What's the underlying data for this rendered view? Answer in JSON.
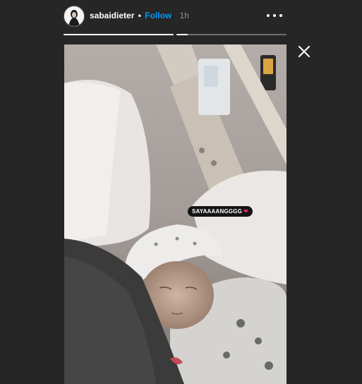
{
  "header": {
    "username": "sabaidieter",
    "separator": "•",
    "follow_label": "Follow",
    "time_ago": "1h"
  },
  "progress": {
    "segments": 2,
    "active_index": 1,
    "active_fraction": 0.1
  },
  "story": {
    "sticker_text": "SAYAAAANGGGG",
    "sticker_emoji": "❤"
  },
  "colors": {
    "background": "#262626",
    "follow": "#0095f6",
    "time": "#8e8e8e"
  },
  "icons": {
    "more": "more-options-icon",
    "close": "close-icon"
  }
}
